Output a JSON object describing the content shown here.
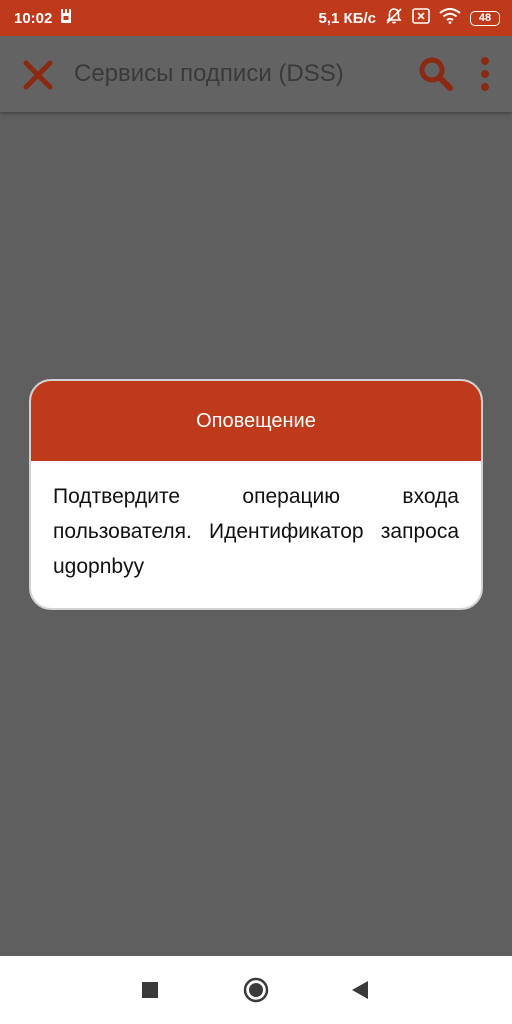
{
  "status_bar": {
    "time": "10:02",
    "net_speed": "5,1 КБ/с",
    "battery_level": "48",
    "icons": [
      "sim-toolkit-icon",
      "bell-off-icon",
      "sim-x-icon",
      "wifi-icon",
      "battery-icon"
    ]
  },
  "app_bar": {
    "title": "Сервисы подписи (DSS)",
    "icons": [
      "close-icon",
      "search-icon",
      "more-vertical-icon"
    ],
    "accent_color": "#bf3a1a"
  },
  "dialog": {
    "title": "Оповещение",
    "message": "Подтвердите операцию входа пользователя. Идентификатор запроса ugopnbyy"
  },
  "nav_bar": {
    "icons": [
      "recents-square-icon",
      "home-circle-icon",
      "back-triangle-icon"
    ]
  },
  "colors": {
    "brand": "#bf3a1a",
    "overlay_background": "#5f5f5f",
    "dialog_background": "#ffffff"
  }
}
